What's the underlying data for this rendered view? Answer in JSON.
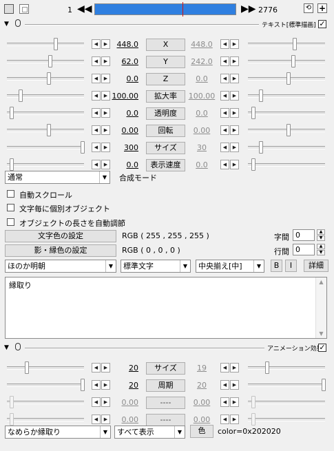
{
  "topbar": {
    "frame_start": "1",
    "frame_end": "2776",
    "prev_icon": "⏪",
    "next_icon": "⏩"
  },
  "section1": {
    "label": "テキスト[標準描画]"
  },
  "rows": [
    {
      "value": "448.0",
      "label": "X",
      "value2": "448.0",
      "disabled": false
    },
    {
      "value": "62.0",
      "label": "Y",
      "value2": "242.0",
      "disabled": false
    },
    {
      "value": "0.0",
      "label": "Z",
      "value2": "0.0",
      "disabled": false
    },
    {
      "value": "100.00",
      "label": "拡大率",
      "value2": "100.00",
      "disabled": false
    },
    {
      "value": "0.0",
      "label": "透明度",
      "value2": "0.0",
      "disabled": false
    },
    {
      "value": "0.00",
      "label": "回転",
      "value2": "0.00",
      "disabled": false
    },
    {
      "value": "300",
      "label": "サイズ",
      "value2": "30",
      "disabled": false
    },
    {
      "value": "0.0",
      "label": "表示速度",
      "value2": "0.0",
      "disabled": false
    }
  ],
  "blend": {
    "value": "通常",
    "label": "合成モード"
  },
  "checks": [
    {
      "label": "自動スクロール"
    },
    {
      "label": "文字毎に個別オブジェクト"
    },
    {
      "label": "オブジェクトの長さを自動調節"
    }
  ],
  "color_btn": "文字色の設定",
  "color_value": "RGB ( 255 , 255 , 255 )",
  "shadow_btn": "影・縁色の設定",
  "shadow_value": "RGB ( 0 , 0 , 0 )",
  "char_spacing": {
    "label": "字間",
    "value": "0"
  },
  "line_spacing": {
    "label": "行間",
    "value": "0"
  },
  "font": "ほのか明朝",
  "font_style": "標準文字",
  "align": "中央揃え[中]",
  "bold": "B",
  "italic": "I",
  "detail": "詳細",
  "text_content": "縁取り",
  "section2": {
    "label": "アニメーション効果"
  },
  "anim_rows": [
    {
      "value": "20",
      "label": "サイズ",
      "value2": "19",
      "disabled": false
    },
    {
      "value": "20",
      "label": "周期",
      "value2": "20",
      "disabled": false
    },
    {
      "value": "0.00",
      "label": "----",
      "value2": "0.00",
      "disabled": true
    },
    {
      "value": "0.00",
      "label": "----",
      "value2": "0.00",
      "disabled": true
    }
  ],
  "effect_select": "なめらか縁取り",
  "display_select": "すべて表示",
  "color_small_btn": "色",
  "color_code": "color=0x202020"
}
